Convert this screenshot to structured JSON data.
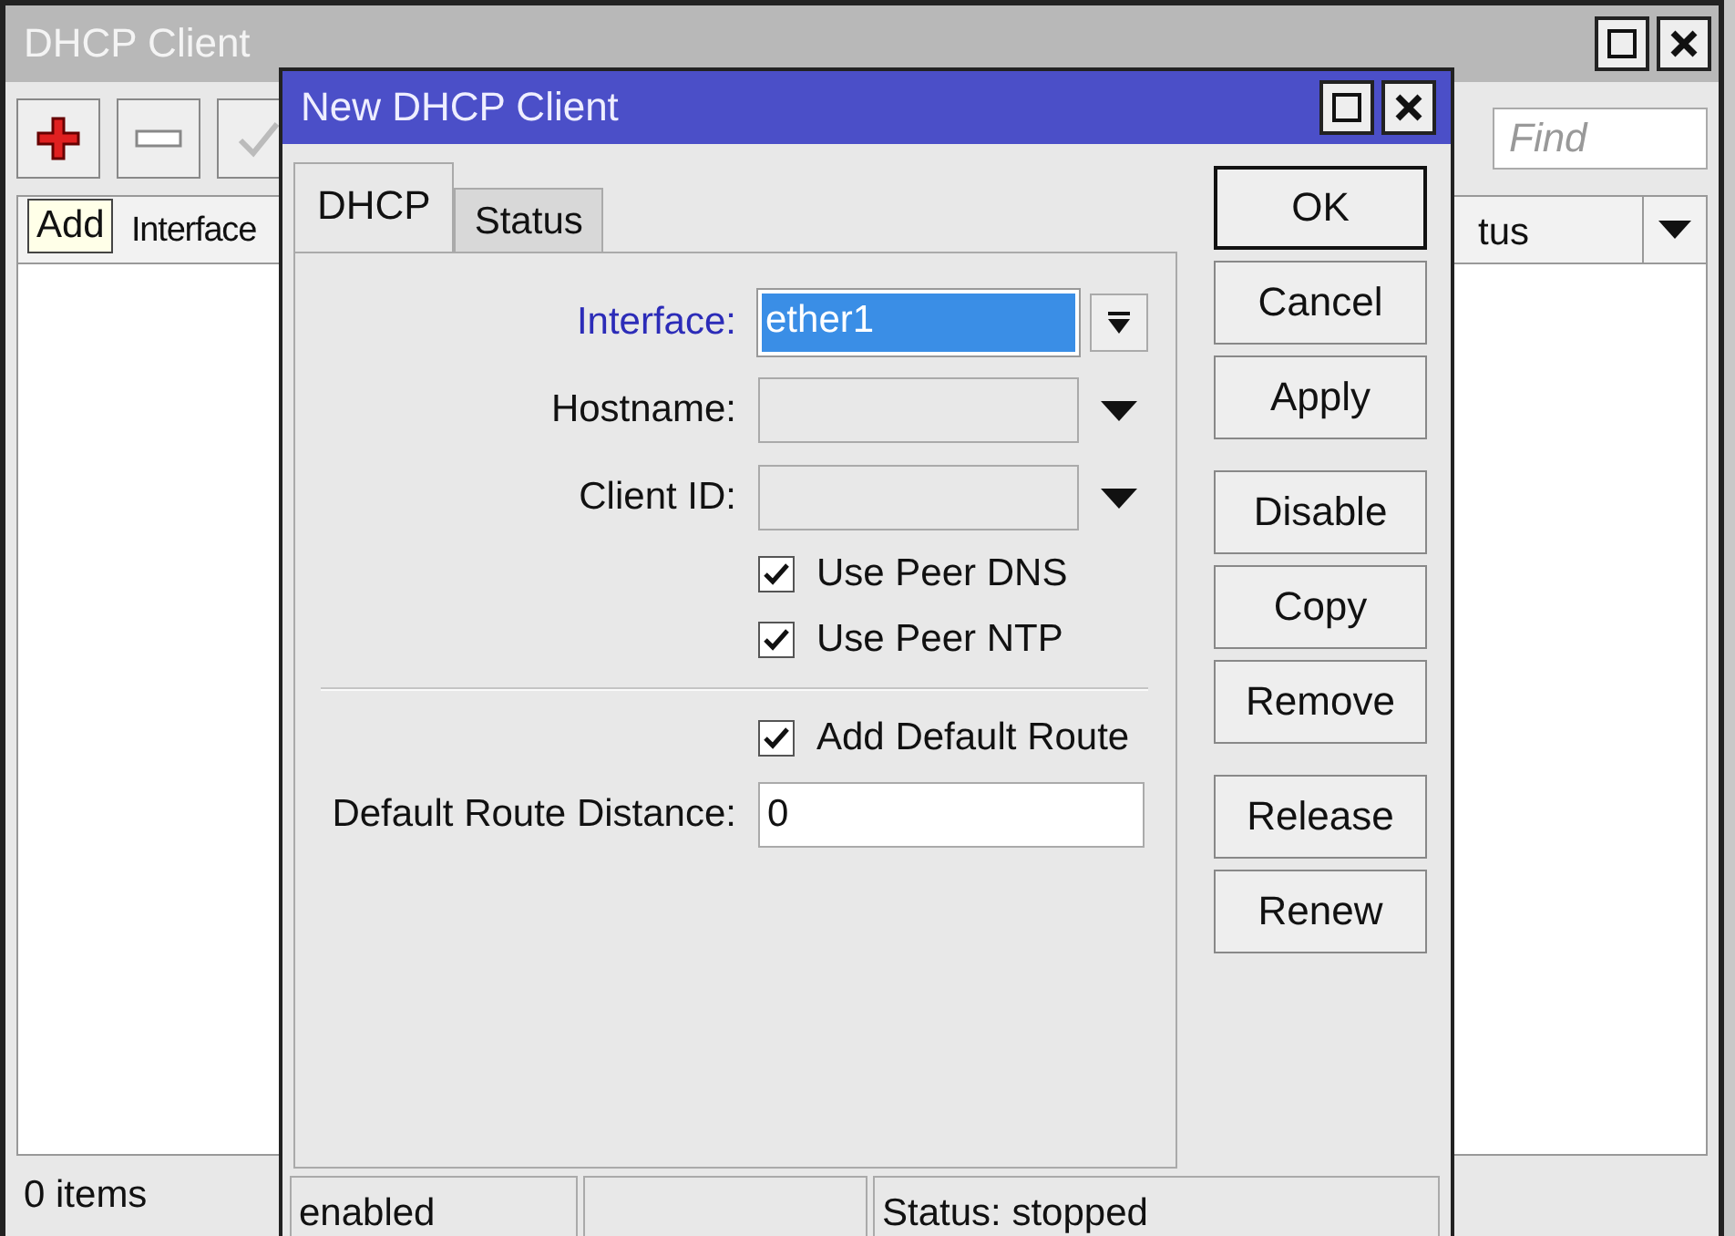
{
  "window": {
    "title": "DHCP Client"
  },
  "find": {
    "placeholder": "Find"
  },
  "tooltip": "Add",
  "table": {
    "columns": [
      "Interface",
      "tus"
    ]
  },
  "footer": "0 items",
  "dialog": {
    "title": "New DHCP Client",
    "tabs": [
      {
        "label": "DHCP",
        "selected": true
      },
      {
        "label": "Status",
        "selected": false
      }
    ],
    "rows": [
      {
        "kind": "select",
        "label": "Interface:",
        "value": "ether1",
        "focused": true
      },
      {
        "kind": "combo",
        "label": "Hostname:",
        "focused": false
      },
      {
        "kind": "combo",
        "label": "Client ID:",
        "focused": false
      },
      {
        "kind": "check",
        "label": "Use Peer DNS",
        "checked": true
      },
      {
        "kind": "check",
        "label": "Use Peer NTP",
        "checked": true
      },
      {
        "kind": "separator"
      },
      {
        "kind": "check",
        "label": "Add Default Route",
        "checked": true
      },
      {
        "kind": "text",
        "label": "Default Route Distance:",
        "value": "0",
        "focused": false
      }
    ],
    "button_groups": [
      [
        {
          "label": "OK",
          "default": true
        },
        {
          "label": "Cancel",
          "default": false
        },
        {
          "label": "Apply",
          "default": false
        }
      ],
      [
        {
          "label": "Disable",
          "default": false
        },
        {
          "label": "Copy",
          "default": false
        },
        {
          "label": "Remove",
          "default": false
        }
      ],
      [
        {
          "label": "Release",
          "default": false
        },
        {
          "label": "Renew",
          "default": false
        }
      ]
    ],
    "status_bar": {
      "left": "enabled",
      "right": "Status: stopped"
    }
  }
}
